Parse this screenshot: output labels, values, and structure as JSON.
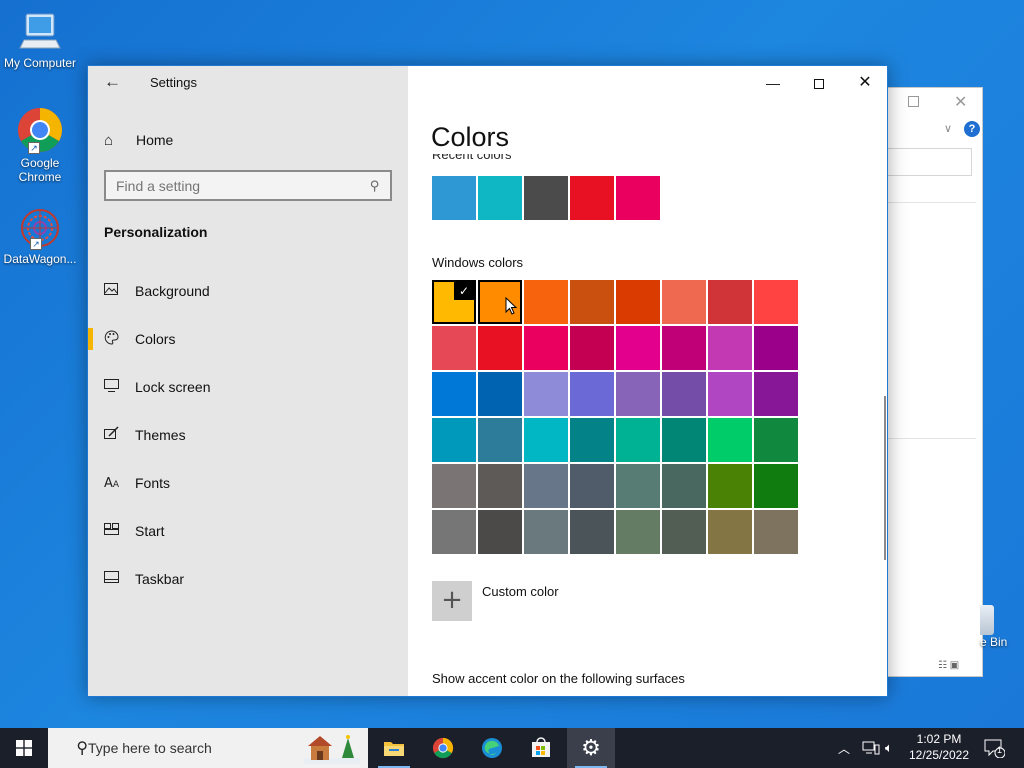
{
  "desktop": {
    "icons": [
      {
        "label": "My Computer"
      },
      {
        "label": "Google Chrome"
      },
      {
        "label": "DataWagon..."
      }
    ],
    "recycle_bin_label": "e Bin",
    "bg_window_help": "?"
  },
  "settings": {
    "app_title": "Settings",
    "home_label": "Home",
    "search_placeholder": "Find a setting",
    "section_heading": "Personalization",
    "nav": [
      {
        "label": "Background",
        "icon": "picture-icon"
      },
      {
        "label": "Colors",
        "icon": "palette-icon",
        "active": true
      },
      {
        "label": "Lock screen",
        "icon": "monitor-icon"
      },
      {
        "label": "Themes",
        "icon": "brush-icon"
      },
      {
        "label": "Fonts",
        "icon": "fonts-icon"
      },
      {
        "label": "Start",
        "icon": "start-icon"
      },
      {
        "label": "Taskbar",
        "icon": "taskbar-icon"
      }
    ],
    "accent_color": "#f6b500",
    "page_title": "Colors",
    "recent_label": "Recent colors",
    "recent_colors": [
      "#2d98d4",
      "#0fb6c3",
      "#4b4b4b",
      "#e81123",
      "#ea005e"
    ],
    "windows_colors_label": "Windows colors",
    "windows_colors": [
      "#ffb900",
      "#ff8c00",
      "#f7630c",
      "#ca5010",
      "#da3b01",
      "#ef6950",
      "#d13438",
      "#ff4343",
      "#e74856",
      "#e81123",
      "#ea005e",
      "#c30052",
      "#e3008c",
      "#bf0077",
      "#c239b3",
      "#9a0089",
      "#0078d7",
      "#0063b1",
      "#8e8cd8",
      "#6b69d6",
      "#8764b8",
      "#744da9",
      "#b146c2",
      "#881798",
      "#0099bc",
      "#2d7d9a",
      "#00b7c3",
      "#038387",
      "#00b294",
      "#018574",
      "#00cc6a",
      "#10893e",
      "#7a7574",
      "#5d5a58",
      "#68768a",
      "#515c6b",
      "#567c73",
      "#486860",
      "#498205",
      "#107c10",
      "#767676",
      "#4c4a48",
      "#69797e",
      "#4a5459",
      "#647c64",
      "#525e54",
      "#847545",
      "#7e735f"
    ],
    "selected_index": 0,
    "hover_index": 1,
    "custom_color_label": "Custom color",
    "show_accent_label": "Show accent color on the following surfaces"
  },
  "taskbar": {
    "search_placeholder": "Type here to search",
    "time": "1:02 PM",
    "date": "12/25/2022",
    "notification_count": "1"
  }
}
